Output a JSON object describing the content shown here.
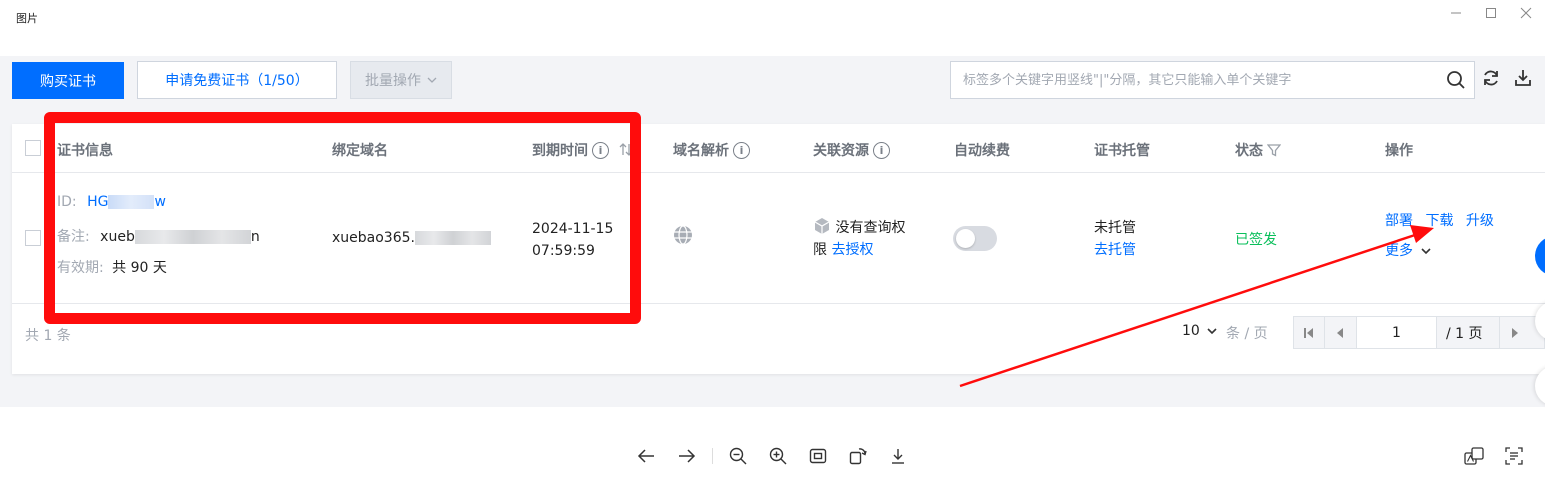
{
  "window": {
    "title": "图片"
  },
  "toolbar": {
    "buy_label": "购买证书",
    "apply_free_label": "申请免费证书（1/50）",
    "batch_label": "批量操作",
    "search_placeholder": "标签多个关键字用竖线\"|\"分隔，其它只能输入单个关键字"
  },
  "table": {
    "headers": {
      "cert_info": "证书信息",
      "domain": "绑定域名",
      "expiry": "到期时间",
      "dns": "域名解析",
      "resource": "关联资源",
      "auto_renew": "自动续费",
      "hosting": "证书托管",
      "status": "状态",
      "actions": "操作"
    },
    "row": {
      "id_label": "ID:",
      "id_value": "HG",
      "id_suffix": "w",
      "remark_label": "备注:",
      "remark_value": "xueb",
      "remark_suffix": "n",
      "validity_label": "有效期:",
      "validity_value": "共 90 天",
      "domain": "xuebao365.",
      "expiry_date": "2024-11-15",
      "expiry_time": "07:59:59",
      "resource_text_1": "没有查询权",
      "resource_text_2": "限",
      "resource_link": "去授权",
      "hosting_status": "未托管",
      "hosting_link": "去托管",
      "status": "已签发",
      "action_deploy": "部署",
      "action_download": "下载",
      "action_upgrade": "升级",
      "action_more": "更多"
    }
  },
  "footer": {
    "total": "共 1 条",
    "page_size": "10",
    "page_size_unit": "条 / 页",
    "page_input": "1",
    "page_total": "/ 1 页"
  },
  "colors": {
    "primary": "#006eff",
    "annotation": "#ff0c0c",
    "success": "#0abf5b"
  }
}
